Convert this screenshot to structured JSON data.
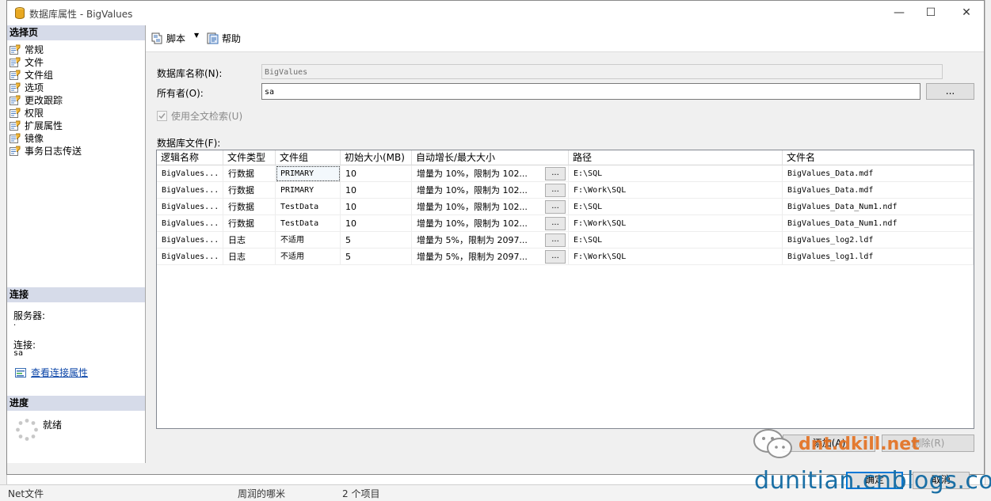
{
  "window": {
    "title": "数据库属性 - BigValues",
    "minimize": "—",
    "maximize": "☐",
    "close": "✕"
  },
  "left": {
    "select_page_header": "选择页",
    "pages": [
      "常规",
      "文件",
      "文件组",
      "选项",
      "更改跟踪",
      "权限",
      "扩展属性",
      "镜像",
      "事务日志传送"
    ],
    "connection_header": "连接",
    "server_label": "服务器:",
    "server_value": ".",
    "connection_label": "连接:",
    "connection_value": "sa",
    "view_props_link": "查看连接属性",
    "progress_header": "进度",
    "progress_status": "就绪"
  },
  "toolbar": {
    "script_label": "脚本",
    "help_label": "帮助"
  },
  "form": {
    "db_name_label": "数据库名称(N):",
    "db_name_value": "BigValues",
    "owner_label": "所有者(O):",
    "owner_value": "sa",
    "owner_browse": "...",
    "fulltext_label": "使用全文检索(U)",
    "db_files_label": "数据库文件(F):"
  },
  "grid": {
    "columns": [
      "逻辑名称",
      "文件类型",
      "文件组",
      "初始大小(MB)",
      "自动增长/最大大小",
      "路径",
      "文件名"
    ],
    "ellipsis": "...",
    "rows": [
      {
        "name": "BigValues...",
        "type": "行数据",
        "group": "PRIMARY",
        "size": "10",
        "growth": "增量为 10%，限制为 102...",
        "path": "E:\\SQL",
        "file": "BigValues_Data.mdf"
      },
      {
        "name": "BigValues...",
        "type": "行数据",
        "group": "PRIMARY",
        "size": "10",
        "growth": "增量为 10%，限制为 102...",
        "path": "F:\\Work\\SQL",
        "file": "BigValues_Data.mdf"
      },
      {
        "name": "BigValues...",
        "type": "行数据",
        "group": "TestData",
        "size": "10",
        "growth": "增量为 10%，限制为 102...",
        "path": "E:\\SQL",
        "file": "BigValues_Data_Num1.ndf"
      },
      {
        "name": "BigValues...",
        "type": "行数据",
        "group": "TestData",
        "size": "10",
        "growth": "增量为 10%，限制为 102...",
        "path": "F:\\Work\\SQL",
        "file": "BigValues_Data_Num1.ndf"
      },
      {
        "name": "BigValues...",
        "type": "日志",
        "group": "不适用",
        "size": "5",
        "growth": "增量为 5%，限制为 2097...",
        "path": "E:\\SQL",
        "file": "BigValues_log2.ldf"
      },
      {
        "name": "BigValues...",
        "type": "日志",
        "group": "不适用",
        "size": "5",
        "growth": "增量为 5%，限制为 2097...",
        "path": "F:\\Work\\SQL",
        "file": "BigValues_log1.ldf"
      }
    ]
  },
  "buttons": {
    "add": "添加(A)",
    "remove": "删除(R)",
    "ok": "确定",
    "cancel": "取消"
  },
  "watermark": {
    "wechat": "dnt.dkill.net",
    "site": "dunitian.cnblogs.com"
  },
  "background": {
    "bottom_left": "Net文件",
    "bottom_mid": "周润的哪米",
    "bottom_right": "2 个项目"
  }
}
